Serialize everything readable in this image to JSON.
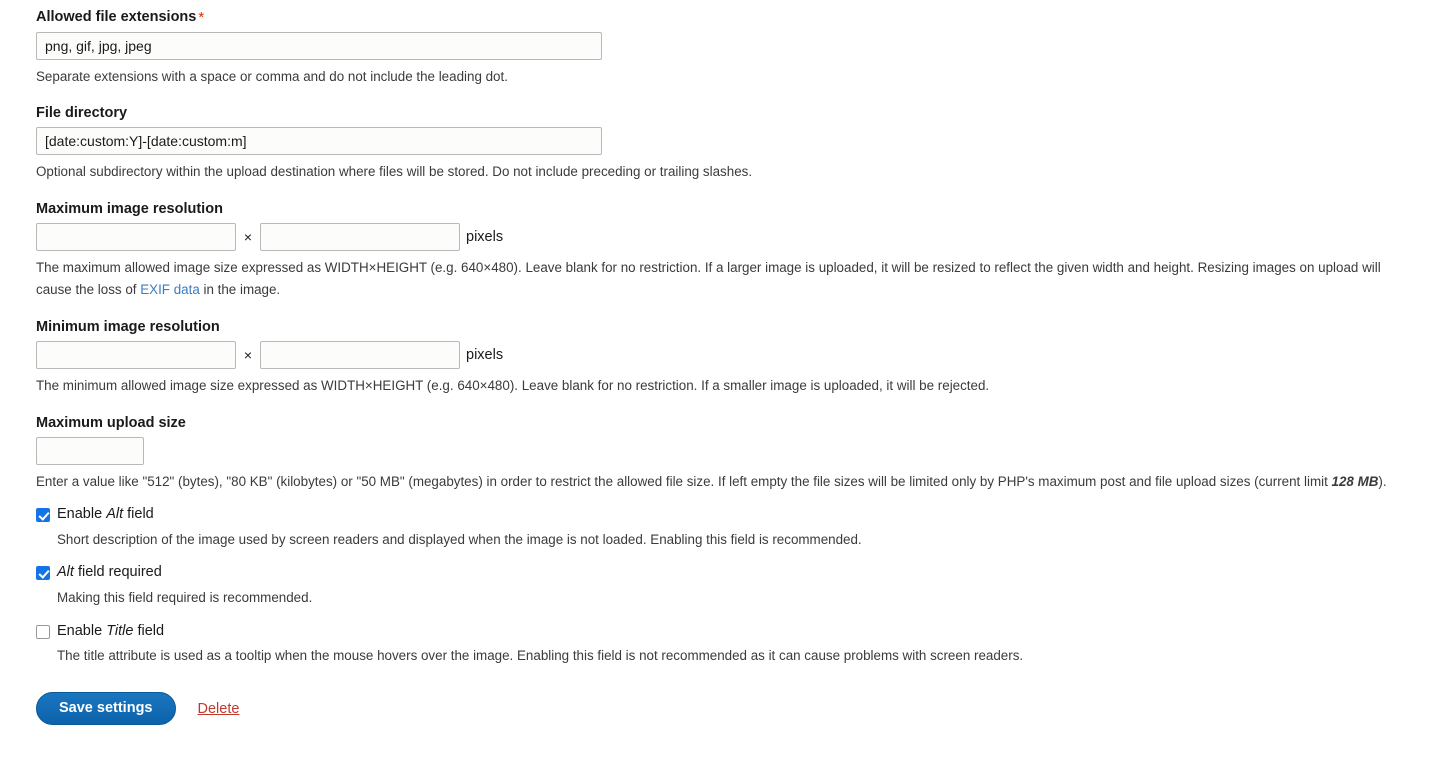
{
  "form": {
    "extensions": {
      "label": "Allowed file extensions",
      "required_mark": "*",
      "value": "png, gif, jpg, jpeg",
      "placeholder": "",
      "description": "Separate extensions with a space or comma and do not include the leading dot."
    },
    "directory": {
      "label": "File directory",
      "value": "[date:custom:Y]-[date:custom:m]",
      "placeholder": "",
      "description": "Optional subdirectory within the upload destination where files will be stored. Do not include preceding or trailing slashes."
    },
    "max_resolution": {
      "label": "Maximum image resolution",
      "width_value": "",
      "width_placeholder": "",
      "height_value": "",
      "height_placeholder": "",
      "separator": "×",
      "suffix": "pixels",
      "description_part1": "The maximum allowed image size expressed as WIDTH×HEIGHT (e.g. 640×480). Leave blank for no restriction. If a larger image is uploaded, it will be resized to reflect the given width and height. Resizing images on upload will cause the loss of ",
      "description_link": "EXIF data",
      "description_part2": " in the image."
    },
    "min_resolution": {
      "label": "Minimum image resolution",
      "width_value": "",
      "width_placeholder": "",
      "height_value": "",
      "height_placeholder": "",
      "separator": "×",
      "suffix": "pixels",
      "description": "The minimum allowed image size expressed as WIDTH×HEIGHT (e.g. 640×480). Leave blank for no restriction. If a smaller image is uploaded, it will be rejected."
    },
    "max_upload_size": {
      "label": "Maximum upload size",
      "value": "",
      "placeholder": "",
      "description_part1": "Enter a value like \"512\" (bytes), \"80 KB\" (kilobytes) or \"50 MB\" (megabytes) in order to restrict the allowed file size. If left empty the file sizes will be limited only by PHP's maximum post and file upload sizes (current limit ",
      "description_limit": "128 MB",
      "description_part2": ")."
    },
    "alt_enable": {
      "label_prefix": "Enable ",
      "label_em": "Alt",
      "label_suffix": " field",
      "checked": true,
      "description": "Short description of the image used by screen readers and displayed when the image is not loaded. Enabling this field is recommended."
    },
    "alt_required": {
      "label_prefix": "",
      "label_em": "Alt",
      "label_suffix": " field required",
      "checked": true,
      "description": "Making this field required is recommended."
    },
    "title_enable": {
      "label_prefix": "Enable ",
      "label_em": "Title",
      "label_suffix": " field",
      "checked": false,
      "description": "The title attribute is used as a tooltip when the mouse hovers over the image. Enabling this field is not recommended as it can cause problems with screen readers."
    },
    "actions": {
      "save_label": "Save settings",
      "delete_label": "Delete"
    }
  },
  "colors": {
    "primary": "#0f69b4",
    "required": "#e32700",
    "link": "#3b7dc1",
    "danger": "#c0392b",
    "checkbox_checked": "#1374e8"
  }
}
